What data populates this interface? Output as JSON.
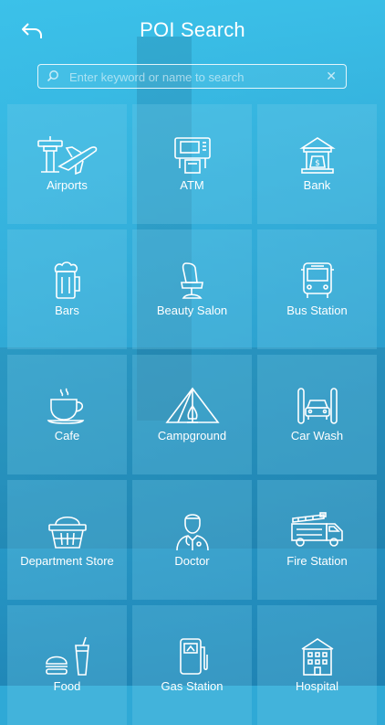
{
  "header": {
    "title": "POI Search",
    "back_icon": "back-arrow-icon"
  },
  "search": {
    "placeholder": "Enter keyword or name to search",
    "value": ""
  },
  "categories": [
    {
      "label": "Airports",
      "icon": "airport-icon"
    },
    {
      "label": "ATM",
      "icon": "atm-icon"
    },
    {
      "label": "Bank",
      "icon": "bank-icon"
    },
    {
      "label": "Bars",
      "icon": "beer-mug-icon"
    },
    {
      "label": "Beauty Salon",
      "icon": "salon-chair-icon"
    },
    {
      "label": "Bus Station",
      "icon": "bus-icon"
    },
    {
      "label": "Cafe",
      "icon": "coffee-cup-icon"
    },
    {
      "label": "Campground",
      "icon": "tent-icon"
    },
    {
      "label": "Car Wash",
      "icon": "car-wash-icon"
    },
    {
      "label": "Department Store",
      "icon": "basket-icon"
    },
    {
      "label": "Doctor",
      "icon": "doctor-icon"
    },
    {
      "label": "Fire Station",
      "icon": "fire-truck-icon"
    },
    {
      "label": "Food",
      "icon": "food-icon"
    },
    {
      "label": "Gas Station",
      "icon": "gas-pump-icon"
    },
    {
      "label": "Hospital",
      "icon": "hospital-icon"
    }
  ]
}
